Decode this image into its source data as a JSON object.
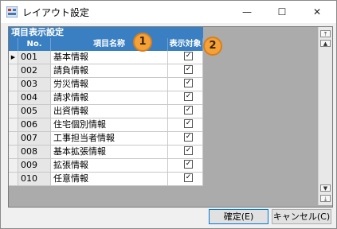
{
  "window": {
    "title": "レイアウト設定",
    "min_glyph": "—",
    "max_glyph": "☐",
    "close_glyph": "✕"
  },
  "grid": {
    "group_header": "項目表示設定",
    "columns": {
      "no": "No.",
      "name": "項目名称",
      "flag": "表示対象"
    },
    "current_row_indicator": "▶",
    "checked_glyph": "✓",
    "rows": [
      {
        "no": "001",
        "name": "基本情報",
        "checked": true
      },
      {
        "no": "002",
        "name": "請負情報",
        "checked": true
      },
      {
        "no": "003",
        "name": "労災情報",
        "checked": true
      },
      {
        "no": "004",
        "name": "請求情報",
        "checked": true
      },
      {
        "no": "005",
        "name": "出資情報",
        "checked": true
      },
      {
        "no": "006",
        "name": "住宅個別情報",
        "checked": true
      },
      {
        "no": "007",
        "name": "工事担当者情報",
        "checked": true
      },
      {
        "no": "008",
        "name": "基本拡張情報",
        "checked": true
      },
      {
        "no": "009",
        "name": "拡張情報",
        "checked": true
      },
      {
        "no": "010",
        "name": "任意情報",
        "checked": true
      }
    ]
  },
  "annotations": {
    "badge1": "1",
    "badge2": "2"
  },
  "scrollbar": {
    "top": "⤒",
    "up": "▲",
    "down": "▼",
    "bottom": "⤓"
  },
  "buttons": {
    "ok": "確定(E)",
    "cancel": "キャンセル(C)"
  },
  "colors": {
    "header_bg": "#3a7fc1",
    "badge": "#f4a13a"
  }
}
